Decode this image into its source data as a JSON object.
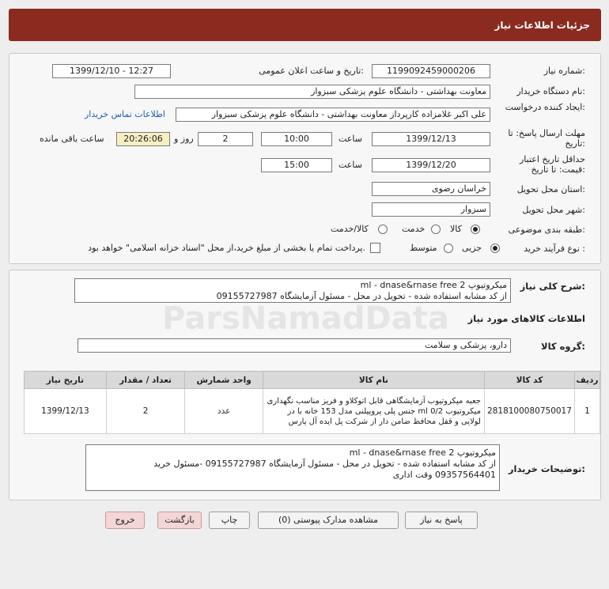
{
  "header": {
    "title": "جزئیات اطلاعات نیاز"
  },
  "form": {
    "need_number_label": "شماره نیاز:",
    "need_number": "1199092459000206",
    "announce_label": "تاریخ و ساعت اعلان عمومی:",
    "announce_value": "1399/12/10 - 12:27",
    "buyer_org_label": "نام دستگاه خریدار:",
    "buyer_org": "معاونت بهداشتی - دانشگاه علوم پزشکی سبزوار",
    "creator_label": "ایجاد کننده درخواست:",
    "creator": "علی اکبر غلامزاده کارپرداز معاونت بهداشتی - دانشگاه علوم پزشکی سبزوار",
    "contact_link": "اطلاعات تماس خریدار",
    "reply_deadline_label": "مهلت ارسال پاسخ: تا تاریخ:",
    "reply_date": "1399/12/13",
    "time_label": "ساعت",
    "reply_time": "10:00",
    "days": "2",
    "days_label": "روز و",
    "remaining": "20:26:06",
    "remaining_label": "ساعت باقی مانده",
    "validity_label": "حداقل تاریخ اعتبار قیمت: تا تاریخ:",
    "validity_date": "1399/12/20",
    "validity_time": "15:00",
    "province_label": "استان محل تحویل:",
    "province": "خراسان رضوی",
    "city_label": "شهر محل تحویل:",
    "city": "سبزوار",
    "category_label": "طبقه بندی موضوعی:",
    "category_options": [
      "کالا",
      "خدمت",
      "کالا/خدمت"
    ],
    "process_label": "نوع فرآیند خرید :",
    "process_options": [
      "جزیی",
      "متوسط"
    ],
    "payment_note": "پرداخت تمام یا بخشی از مبلغ خرید،از محل \"اسناد خزانه اسلامی\" خواهد بود."
  },
  "summary": {
    "label": "شرح کلی نیاز:",
    "lines": [
      "میکروتیوپ 2 ml -  dnase&rnase free",
      "از کد مشابه استفاده شده - تحویل در محل - مسئول آزمایشگاه 09155727987"
    ]
  },
  "goods": {
    "title": "اطلاعات کالاهای مورد نیاز",
    "group_label": "گروه کالا:",
    "group_value": "دارو، پزشکی و سلامت",
    "columns": [
      "ردیف",
      "کد کالا",
      "نام کالا",
      "واحد شمارش",
      "تعداد / مقدار",
      "تاریخ نیاز"
    ],
    "rows": [
      {
        "row": "1",
        "code": "2818100080750017",
        "name": "جعبه میکروتیوب آزمایشگاهی قابل اتوکلاو و فریز مناسب نگهداری میکروتیوب ml 0/2 جنس پلی پروپیلنی مدل 153 خانه با در لولایی و قفل محافظ ضامن دار از شرکت پل ایده آل پارس",
        "unit": "عدد",
        "qty": "2",
        "date": "1399/12/13"
      }
    ]
  },
  "buyer_notes": {
    "label": "توضیحات خریدار:",
    "lines": [
      "میکروتیوپ 2 ml -  dnase&rnase free",
      "از کد مشابه استفاده شده - تحویل در محل - مسئول آزمایشگاه 09155727987 -مسئول خرید",
      "09357564401 وقت اداری"
    ]
  },
  "buttons": {
    "reply": "پاسخ به نیاز",
    "docs": "مشاهده مدارک پیوستی (0)",
    "print": "چاپ",
    "back": "بازگشت",
    "exit": "خروج"
  },
  "watermark": {
    "brand": "ParsNamadData"
  }
}
